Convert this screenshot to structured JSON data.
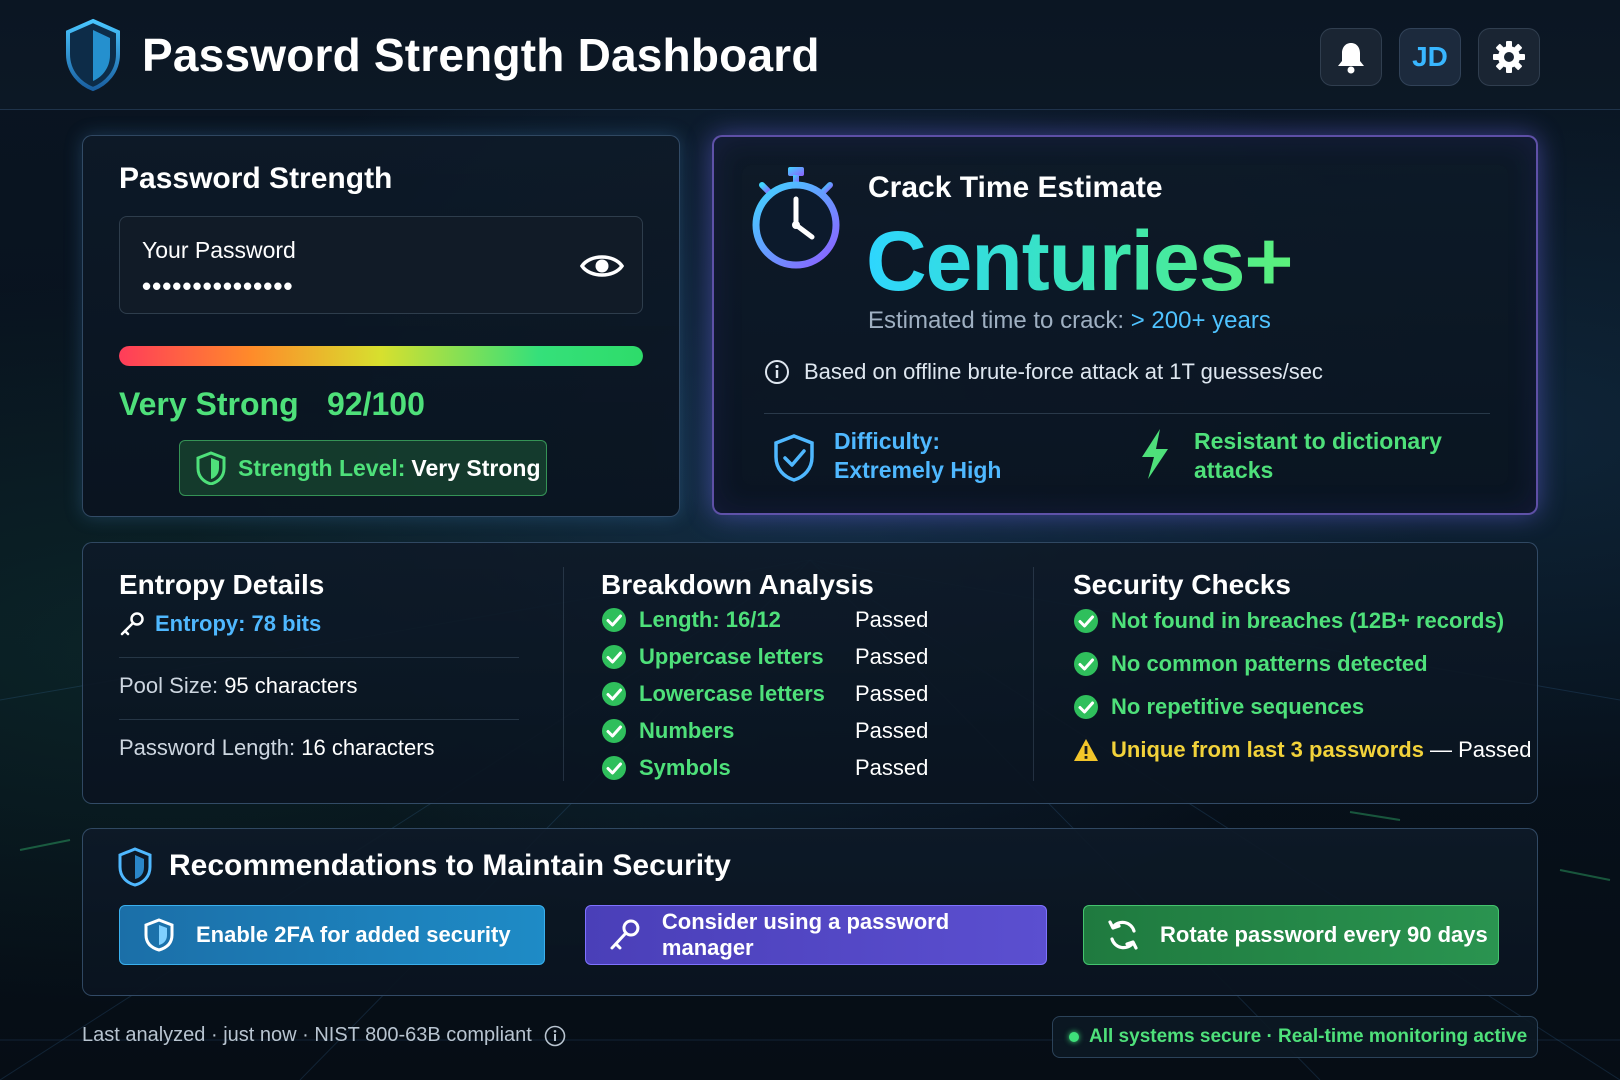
{
  "header": {
    "title": "Password Strength Dashboard",
    "avatar_initials": "JD",
    "icons": [
      "shield-logo-icon",
      "bell-icon",
      "gear-icon"
    ]
  },
  "strength": {
    "title": "Password Strength",
    "input_label": "Your Password",
    "input_value": "•••••••••••••••",
    "meter_fraction": 1.0,
    "level_word": "Very Strong",
    "score": "92/100",
    "badge_label": "Strength Level:",
    "badge_value": "Very Strong"
  },
  "crack": {
    "title": "Crack Time Estimate",
    "value": "Centuries+",
    "estimate_prefix": "Estimated time to crack:",
    "estimate_value": "> 200+ years",
    "basis": "Based on offline brute-force attack at 1T guesses/sec",
    "difficulty_line1": "Difficulty:",
    "difficulty_line2": "Extremely High",
    "resistance_line1": "Resistant to dictionary",
    "resistance_line2": "attacks"
  },
  "entropy": {
    "title": "Entropy Details",
    "entropy": "Entropy: 78 bits",
    "pool_label": "Pool Size:",
    "pool_value": "95 characters",
    "length_label": "Password Length:",
    "length_value": "16 characters"
  },
  "breakdown": {
    "title": "Breakdown Analysis",
    "rows": [
      {
        "name": "Length: 16/12",
        "status": "Passed"
      },
      {
        "name": "Uppercase letters",
        "status": "Passed"
      },
      {
        "name": "Lowercase letters",
        "status": "Passed"
      },
      {
        "name": "Numbers",
        "status": "Passed"
      },
      {
        "name": "Symbols",
        "status": "Passed"
      }
    ]
  },
  "security": {
    "title": "Security Checks",
    "rows": [
      {
        "text": "Not found in breaches (12B+ records)"
      },
      {
        "text": "No common patterns detected"
      },
      {
        "text": "No repetitive sequences"
      },
      {
        "text": "Unique from last 3 passwords",
        "suffix": "— Passed"
      }
    ]
  },
  "recommendations": {
    "title": "Recommendations to Maintain Security",
    "buttons": [
      {
        "label": "Enable 2FA for added security"
      },
      {
        "label": "Consider using a password manager"
      },
      {
        "label": "Rotate password every 90 days"
      }
    ]
  },
  "footer": {
    "left": "Last analyzed · just now · NIST 800-63B compliant",
    "right": "All systems secure · Real-time monitoring active"
  },
  "colors": {
    "accent_green": "#4ee07a",
    "accent_blue": "#4fb8ff",
    "accent_purple": "#7f72ff",
    "warning_yellow": "#f2d23a"
  }
}
